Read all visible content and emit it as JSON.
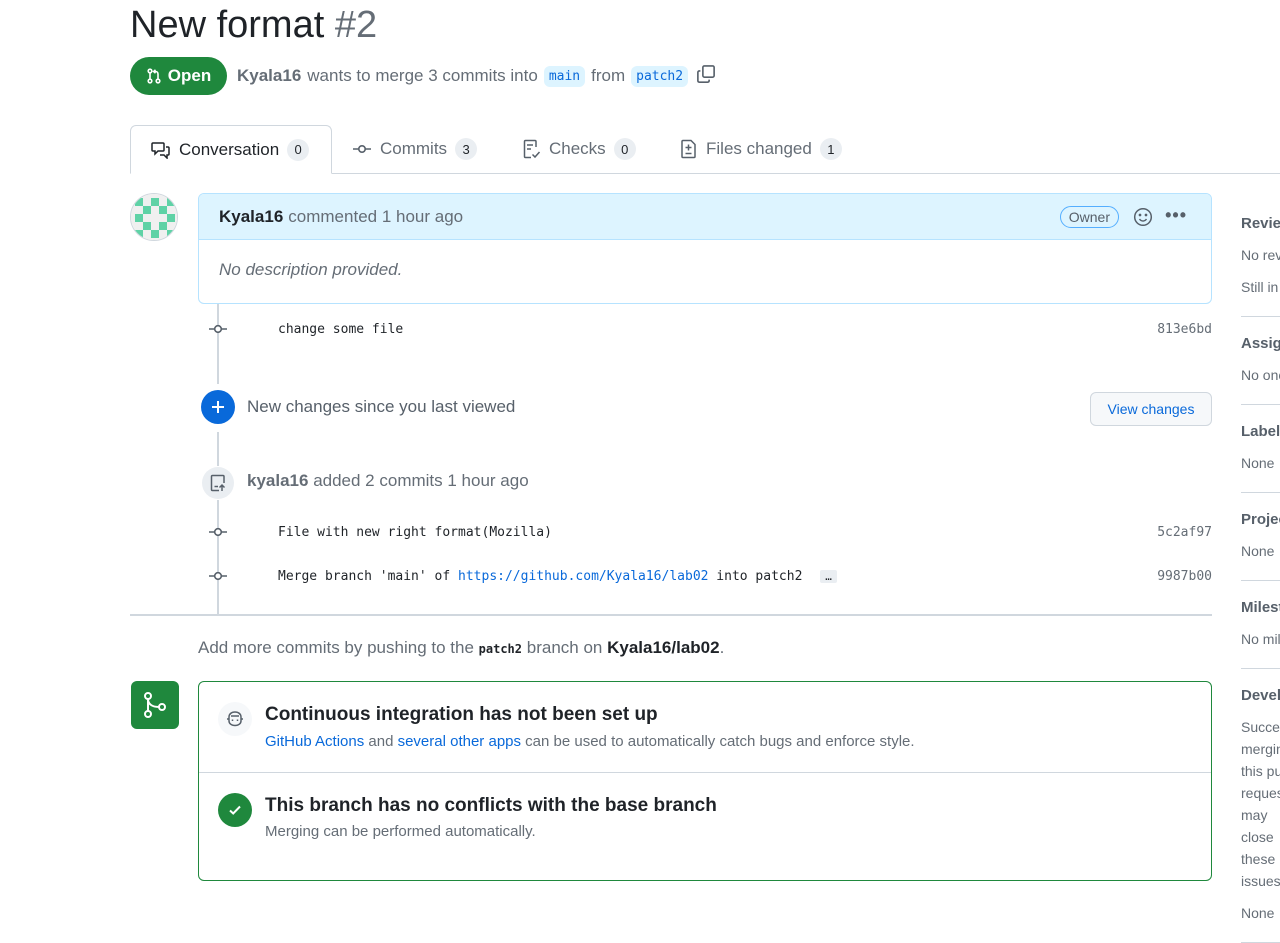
{
  "pr": {
    "title": "New format",
    "number": "#2",
    "state_label": "Open",
    "author": "Kyala16",
    "merge_text": "wants to merge 3 commits into",
    "base_branch": "main",
    "from_text": "from",
    "head_branch": "patch2"
  },
  "tabs": [
    {
      "label": "Conversation",
      "count": "0"
    },
    {
      "label": "Commits",
      "count": "3"
    },
    {
      "label": "Checks",
      "count": "0"
    },
    {
      "label": "Files changed",
      "count": "1"
    }
  ],
  "comment": {
    "author": "Kyala16",
    "action": "commented",
    "time": "1 hour ago",
    "role_badge": "Owner",
    "body": "No description provided."
  },
  "commits_first": [
    {
      "message": "change some file",
      "sha": "813e6bd"
    }
  ],
  "new_changes": {
    "text": "New changes since you last viewed",
    "button": "View changes"
  },
  "push_event": {
    "author": "kyala16",
    "text": "added 2 commits",
    "time": "1 hour ago"
  },
  "commits_second": [
    {
      "message": "File with new right format(Mozilla)",
      "sha": "5c2af97"
    },
    {
      "message_prefix": "Merge branch 'main' of",
      "link": "https://github.com/Kyala16/lab02",
      "message_suffix": "into patch2",
      "ellipsis": "…",
      "sha": "9987b00"
    }
  ],
  "add_more": {
    "prefix": "Add more commits by pushing to the",
    "branch": "patch2",
    "middle": "branch on",
    "repo": "Kyala16/lab02",
    "suffix": "."
  },
  "merge_box": {
    "ci_title": "Continuous integration has not been set up",
    "ci_link1": "GitHub Actions",
    "ci_and": "and",
    "ci_link2": "several other apps",
    "ci_rest": "can be used to automatically catch bugs and enforce style.",
    "conflict_title": "This branch has no conflicts with the base branch",
    "conflict_sub": "Merging can be performed automatically."
  },
  "sidebar": [
    {
      "heading": "Reviewers",
      "values": [
        "No reviews",
        "Still in progress?"
      ]
    },
    {
      "heading": "Assignees",
      "values": [
        "No one"
      ]
    },
    {
      "heading": "Labels",
      "values": [
        "None"
      ]
    },
    {
      "heading": "Projects",
      "values": [
        "None"
      ]
    },
    {
      "heading": "Milestone",
      "values": [
        "No milestone"
      ]
    },
    {
      "heading": "Development",
      "values": [
        "Successfully merging this pull request may close these issues.",
        "None"
      ]
    }
  ],
  "colors": {
    "open_green": "#1f883d",
    "link_blue": "#0969da",
    "comment_header_bg": "#ddf4ff"
  }
}
